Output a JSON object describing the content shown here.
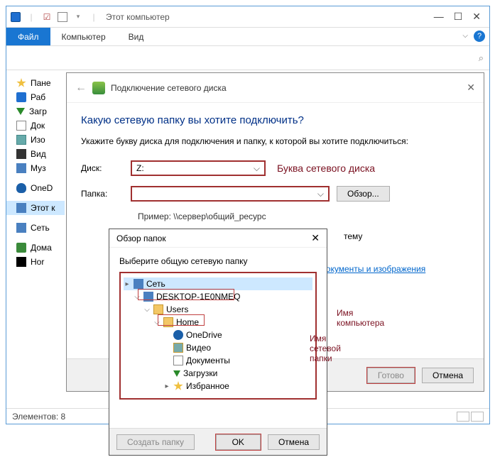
{
  "explorer": {
    "title": "Этот компьютер",
    "tabs": {
      "file": "Файл",
      "computer": "Компьютер",
      "view": "Вид"
    },
    "sidebar": [
      {
        "label": "Пане",
        "icon": "ic-star"
      },
      {
        "label": "Раб",
        "icon": "ic-blue"
      },
      {
        "label": "Загр",
        "icon": "ic-dl"
      },
      {
        "label": "Док",
        "icon": "ic-doc"
      },
      {
        "label": "Изо",
        "icon": "ic-pic"
      },
      {
        "label": "Вид",
        "icon": "ic-vid"
      },
      {
        "label": "Муз",
        "icon": "ic-mus"
      }
    ],
    "sidebar2": [
      {
        "label": "OneD",
        "icon": "ic-cloud"
      }
    ],
    "sidebar3": [
      {
        "label": "Этот к",
        "icon": "ic-pc",
        "selected": true
      }
    ],
    "sidebar4": [
      {
        "label": "Сеть",
        "icon": "ic-net"
      }
    ],
    "sidebar5": [
      {
        "label": "Дома",
        "icon": "ic-home"
      },
      {
        "label": "Hor",
        "icon": "ic-black"
      }
    ],
    "status": "Элементов: 8"
  },
  "wizard": {
    "title": "Подключение сетевого диска",
    "heading": "Какую сетевую папку вы хотите подключить?",
    "subheading": "Укажите букву диска для подключения и папку, к которой вы хотите подключиться:",
    "drive_label": "Диск:",
    "drive_value": "Z:",
    "drive_annot": "Буква сетевого диска",
    "folder_label": "Папка:",
    "browse_btn": "Обзор...",
    "example": "Пример: \\\\сервер\\общий_ресурс",
    "store_link": "е хранить документы и изображения",
    "reconnect_partial": "тему",
    "done": "Готово",
    "cancel": "Отмена"
  },
  "browse": {
    "title": "Обзор папок",
    "sub": "Выберите общую сетевую папку",
    "tree": {
      "network": "Сеть",
      "computer": "DESKTOP-1E0NMEQ",
      "users": "Users",
      "home": "Home",
      "onedrive": "OneDrive",
      "video": "Видео",
      "documents": "Документы",
      "downloads": "Загрузки",
      "favorites": "Избранное"
    },
    "annot_computer": "Имя компьютера",
    "annot_folder": "Имя сетевой папки",
    "new_folder": "Создать папку",
    "ok": "OK",
    "cancel": "Отмена"
  }
}
